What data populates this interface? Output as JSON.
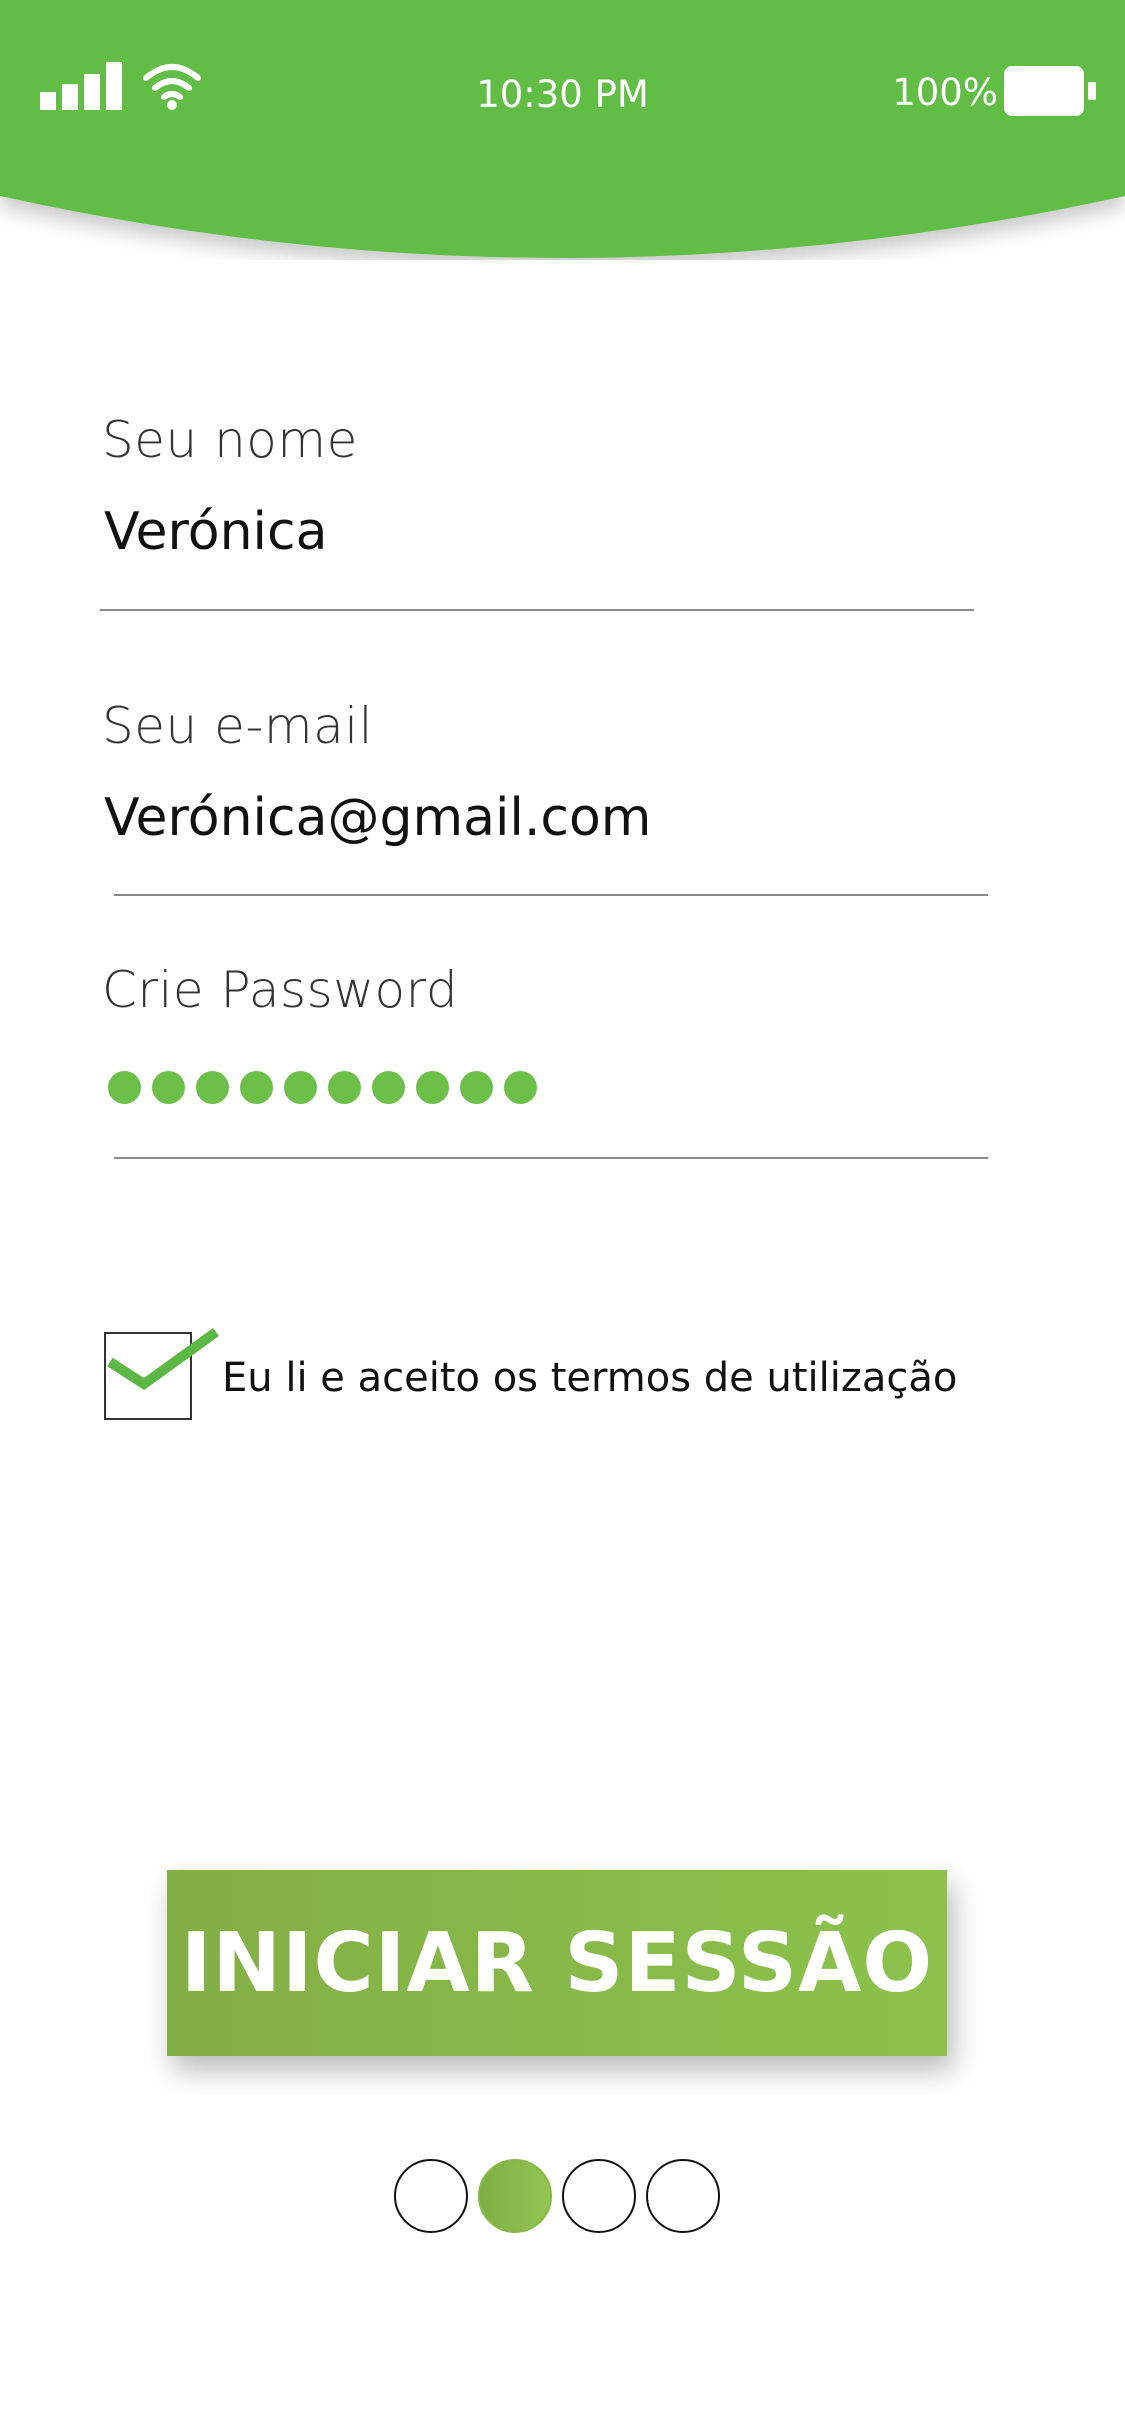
{
  "status_bar": {
    "time": "10:30 PM",
    "battery_percent": "100%",
    "signal_icon": "cellular-signal-icon",
    "wifi_icon": "wifi-icon",
    "battery_icon": "battery-icon"
  },
  "form": {
    "name": {
      "label": "Seu nome",
      "value": "Verónica"
    },
    "email": {
      "label": "Seu e-mail",
      "value": "Verónica@gmail.com"
    },
    "password": {
      "label": "Crie Password",
      "masked_length": 10
    },
    "terms": {
      "checked": true,
      "label": "Eu li e aceito os termos de utilização"
    }
  },
  "primary_button": {
    "label": "INICIAR SESSÃO"
  },
  "pagination": {
    "total": 4,
    "active": 2
  },
  "colors": {
    "brand_green": "#62bd47",
    "button_green": "#86b949",
    "password_dot": "#6cc04a"
  }
}
